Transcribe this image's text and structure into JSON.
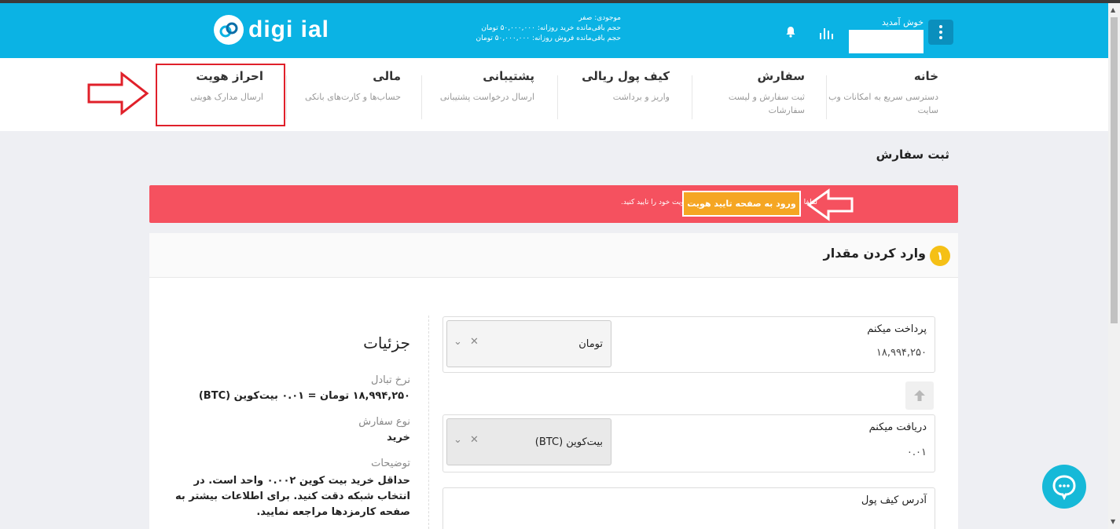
{
  "header": {
    "logo_text": "digi ial",
    "balance_lines": [
      "موجودی: صفر",
      "حجم باقی‌مانده خرید روزانه: ۵۰,۰۰۰,۰۰۰ تومان",
      "حجم باقی‌مانده فروش روزانه: ۵۰,۰۰۰,۰۰۰ تومان"
    ],
    "welcome": "خوش آمدید"
  },
  "nav": {
    "items": [
      {
        "title": "خانه",
        "sub": "دسترسی سریع به امکانات وب سایت"
      },
      {
        "title": "سفارش",
        "sub": "ثبت سفارش و لیست سفارشات"
      },
      {
        "title": "کیف پول ریالی",
        "sub": "واریز و برداشت"
      },
      {
        "title": "پشتیبانی",
        "sub": "ارسال درخواست پشتیبانی"
      },
      {
        "title": "مالی",
        "sub": "حساب‌ها و کارت‌های بانکی"
      },
      {
        "title": "احراز هویت",
        "sub": "ارسال مدارک هویتی"
      }
    ]
  },
  "page": {
    "title": "ثبت سفارش"
  },
  "alert": {
    "message": "لطفا برای ثبت سفارش خرید در سایت ابتدا هویت خود را تایید کنید.",
    "button_label": "ورود به صفحه تایید هویت"
  },
  "step": {
    "number": "۱",
    "title": "وارد کردن مقدار"
  },
  "form": {
    "pay": {
      "label": "پرداخت میکنم",
      "value": "۱۸,۹۹۴,۲۵۰",
      "currency": "تومان"
    },
    "receive": {
      "label": "دریافت میکنم",
      "value": "۰.۰۱",
      "currency": "بیت‌کوین (BTC)"
    },
    "wallet": {
      "label": "آدرس کیف پول"
    }
  },
  "details": {
    "title": "جزئیات",
    "rate_label": "نرخ تبادل",
    "rate_value": "۱۸,۹۹۴,۲۵۰ تومان = ۰.۰۱ بیت‌کوین (BTC)",
    "type_label": "نوع سفارش",
    "type_value": "خرید",
    "desc_label": "توضیحات",
    "desc_value": "حداقل خرید بیت کوین ۰.۰۰۲ واحد است. در انتخاب شبکه دقت کنید. برای اطلاعات بیشتر به صفحه کارمزدها مراجعه نمایید."
  },
  "colors": {
    "header": "#0bb3e4",
    "alert": "#f5515f",
    "alert_button": "#f5a623",
    "step_badge": "#f5c016",
    "annotation": "#e0202a"
  }
}
